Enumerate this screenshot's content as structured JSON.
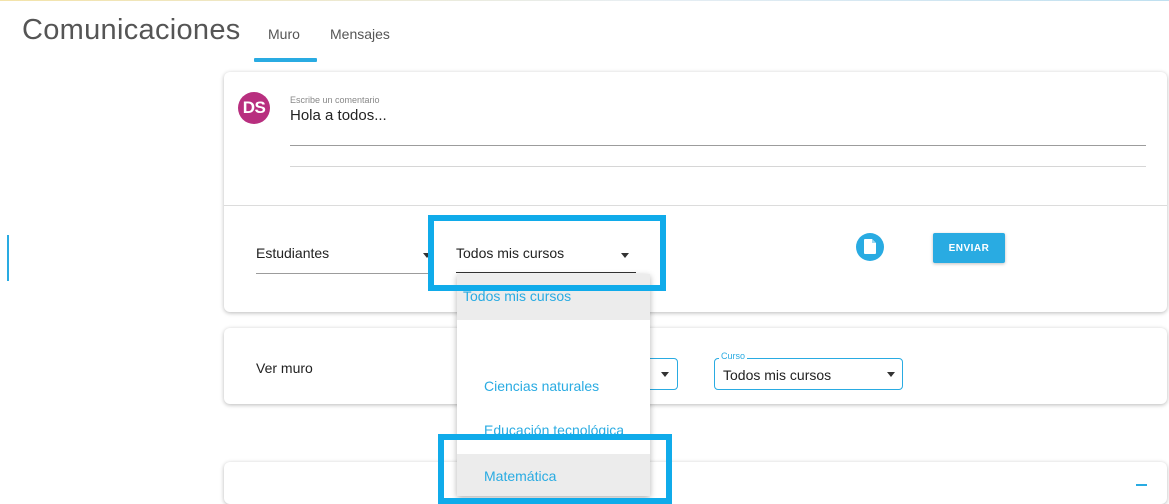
{
  "header": {
    "title": "Comunicaciones",
    "tabs": [
      {
        "label": "Muro",
        "active": true
      },
      {
        "label": "Mensajes",
        "active": false
      }
    ]
  },
  "composer": {
    "avatar_initials": "DS",
    "input_label": "Escribe un comentario",
    "input_value": "Hola a todos...",
    "recipient_select": "Estudiantes",
    "course_select": "Todos mis cursos",
    "attach_icon": "file-icon",
    "send_label": "ENVIAR"
  },
  "wall_filter": {
    "label": "Ver muro",
    "course_legend": "Curso",
    "course_value": "Todos mis cursos"
  },
  "dropdown": {
    "options": [
      "Todos mis cursos",
      "",
      "Ciencias naturales",
      "Educación tecnológica",
      "Matemática"
    ]
  },
  "colors": {
    "accent": "#29abe2",
    "avatar": "#b82f7f",
    "highlight": "#10abea"
  }
}
